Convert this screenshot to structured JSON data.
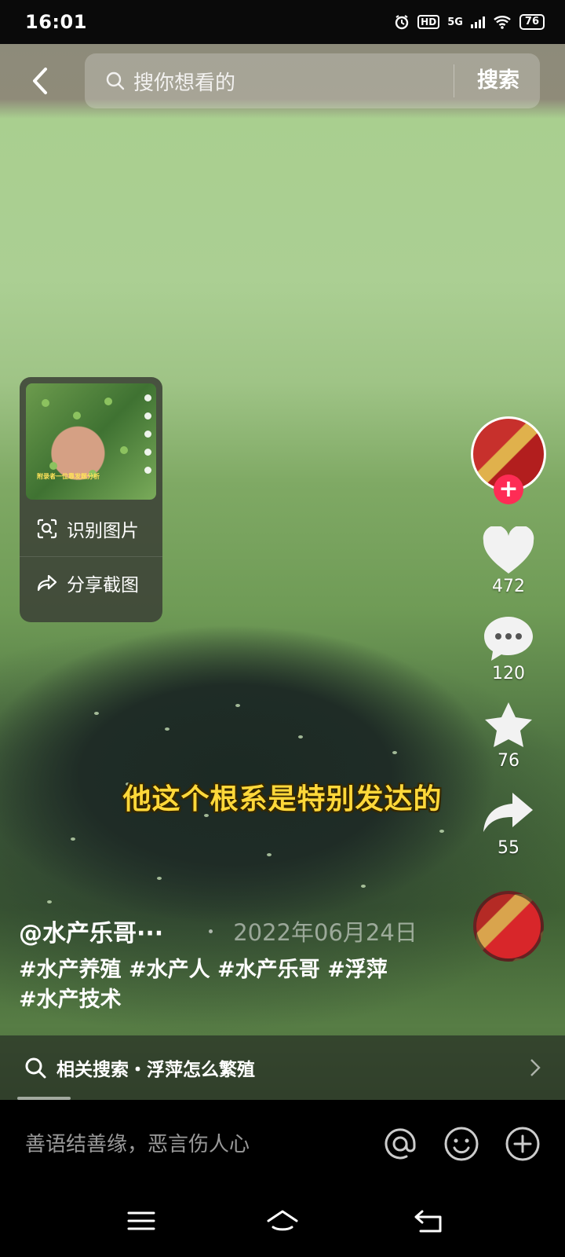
{
  "status_bar": {
    "time": "16:01",
    "network": "5G",
    "hd": "HD",
    "battery": "76"
  },
  "search": {
    "placeholder": "搜你想看的",
    "button_label": "搜索"
  },
  "popup": {
    "thumbnail_caption": "附录者一位靠发题分析",
    "identify_label": "识别图片",
    "share_label": "分享截图"
  },
  "rail": {
    "likes": "472",
    "comments": "120",
    "favorites": "76",
    "shares": "55",
    "follow_symbol": "+"
  },
  "video": {
    "subtitle": "他这个根系是特别发达的",
    "author": "@水产乐哥···",
    "date": "2022年06月24日",
    "hashtags": "#水产养殖 #水产人 #水产乐哥 #浮萍 #水产技术",
    "progress": 0.1
  },
  "related": {
    "label": "相关搜索・浮萍怎么繁殖"
  },
  "comment": {
    "placeholder": "善语结善缘，恶言伤人心"
  },
  "icons": {
    "back": "back-arrow-icon",
    "search": "search-icon",
    "identify": "scan-icon",
    "share": "share-arrow-icon",
    "like": "heart-icon",
    "comment": "comment-bubble-icon",
    "favorite": "star-icon",
    "forward": "forward-arrow-icon",
    "mention": "at-icon",
    "emoji": "emoji-icon",
    "add": "plus-circle-icon"
  },
  "colors": {
    "accent": "#fe2c55",
    "subtitle": "#ffd83a"
  }
}
